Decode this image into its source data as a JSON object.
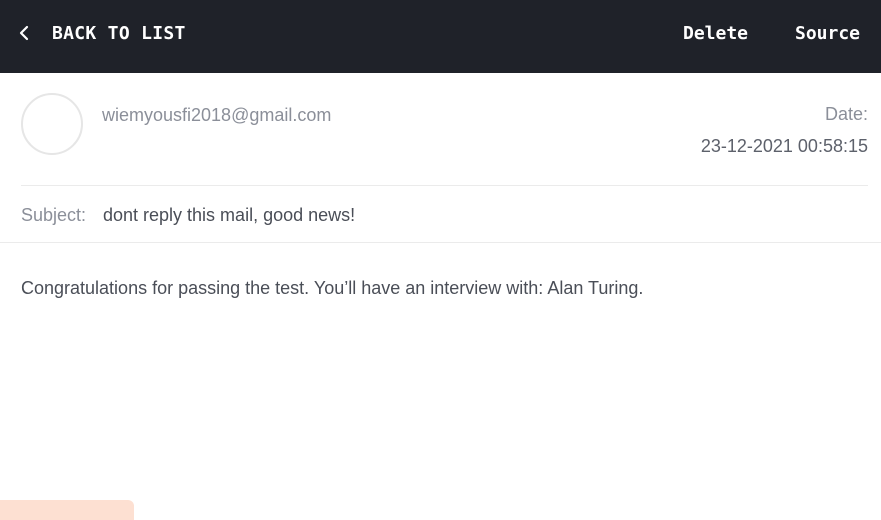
{
  "topbar": {
    "back_icon": "chevron-left-icon",
    "back_label": "BACK TO LIST",
    "delete_label": "Delete",
    "source_label": "Source"
  },
  "message": {
    "sender": "wiemyousfi2018@gmail.com",
    "date_label": "Date:",
    "date_value": "23-12-2021 00:58:15",
    "subject_label": "Subject:",
    "subject_value": "dont reply this mail, good news!",
    "body": "Congratulations for passing the test. You’ll have an interview with: Alan Turing."
  },
  "colors": {
    "topbar_bg": "#1f2229",
    "muted_text": "#8b8f99",
    "body_text": "#4a4e57",
    "accent_tab": "#fde0d2"
  }
}
